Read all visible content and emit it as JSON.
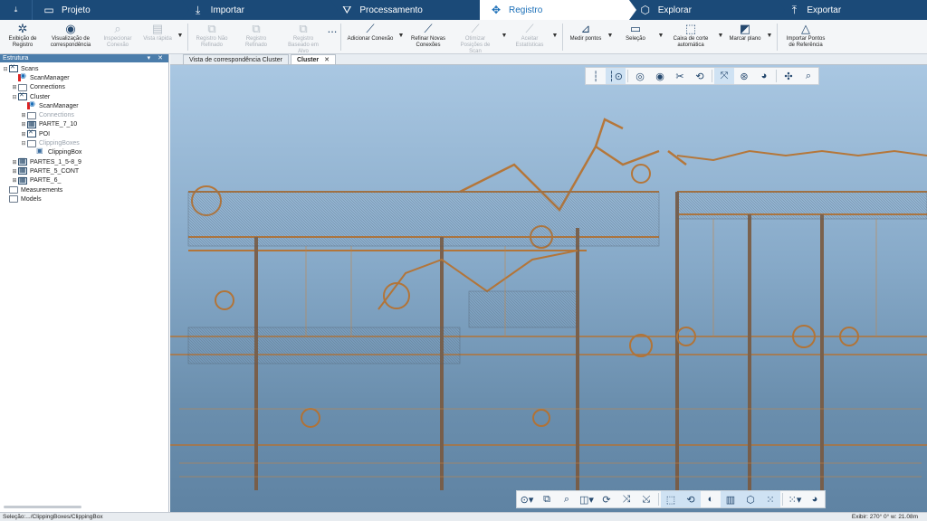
{
  "nav": {
    "tabs": [
      {
        "label": "Projeto",
        "icon": "folder-icon"
      },
      {
        "label": "Importar",
        "icon": "import-icon"
      },
      {
        "label": "Processamento",
        "icon": "filter-icon"
      },
      {
        "label": "Registro",
        "icon": "registration-icon"
      },
      {
        "label": "Explorar",
        "icon": "explore-icon"
      },
      {
        "label": "Exportar",
        "icon": "export-icon"
      }
    ],
    "active": "Registro"
  },
  "ribbon": {
    "buttons": [
      {
        "label": "Exibição de Registro",
        "icon": "registration-view-icon",
        "disabled": false
      },
      {
        "label": "Visualização de correspondência",
        "icon": "correspondence-view-icon",
        "disabled": false
      },
      {
        "label": "Inspecionar Conexão",
        "icon": "inspect-icon",
        "disabled": true
      },
      {
        "label": "Vista rápida",
        "icon": "quick-view-icon",
        "disabled": true
      },
      {
        "label": "Registro Não Refinado",
        "icon": "unrefined-icon",
        "disabled": true
      },
      {
        "label": "Registro Refinado",
        "icon": "refined-icon",
        "disabled": true
      },
      {
        "label": "Registro Baseado em Alvo",
        "icon": "target-icon",
        "disabled": true
      },
      {
        "label": "Adicionar Conexão",
        "icon": "add-connection-icon",
        "disabled": false
      },
      {
        "label": "Refinar Novas Conexões",
        "icon": "refine-icon",
        "disabled": false
      },
      {
        "label": "Otimizar Posições de Scan",
        "icon": "optimize-icon",
        "disabled": true
      },
      {
        "label": "Aceitar Estatísticas",
        "icon": "statistics-icon",
        "disabled": true
      },
      {
        "label": "Medir pontos",
        "icon": "measure-icon",
        "disabled": false
      },
      {
        "label": "Seleção",
        "icon": "selection-icon",
        "disabled": false
      },
      {
        "label": "Caixa de corte automática",
        "icon": "clipping-box-icon",
        "disabled": false
      },
      {
        "label": "Marcar plano",
        "icon": "mark-plane-icon",
        "disabled": false
      },
      {
        "label": "Importar Pontos de Referência",
        "icon": "reference-points-icon",
        "disabled": false
      }
    ],
    "more": "..."
  },
  "panel": {
    "title": "Estrutura",
    "controls": "▾ ✕",
    "tree": [
      {
        "label": "Scans",
        "level": 0,
        "exp": "⊟",
        "icon": "cluster",
        "dim": false
      },
      {
        "label": "ScanManager",
        "level": 1,
        "exp": "",
        "icon": "scan",
        "dim": false
      },
      {
        "label": "Connections",
        "level": 1,
        "exp": "⊞",
        "icon": "folder",
        "dim": false
      },
      {
        "label": "Cluster",
        "level": 1,
        "exp": "⊟",
        "icon": "cluster",
        "dim": false
      },
      {
        "label": "ScanManager",
        "level": 2,
        "exp": "",
        "icon": "scan",
        "dim": false
      },
      {
        "label": "Connections",
        "level": 2,
        "exp": "⊞",
        "icon": "folder",
        "dim": true
      },
      {
        "label": "PARTE_7_10",
        "level": 2,
        "exp": "⊞",
        "icon": "part",
        "dim": false
      },
      {
        "label": "POI",
        "level": 2,
        "exp": "⊞",
        "icon": "cluster",
        "dim": false
      },
      {
        "label": "ClippingBoxes",
        "level": 2,
        "exp": "⊟",
        "icon": "folder",
        "dim": true
      },
      {
        "label": "ClippingBox",
        "level": 3,
        "exp": "",
        "icon": "box",
        "dim": false
      },
      {
        "label": "PARTES_1_5-8_9",
        "level": 1,
        "exp": "⊞",
        "icon": "part",
        "dim": false
      },
      {
        "label": "PARTE_5_CONT",
        "level": 1,
        "exp": "⊞",
        "icon": "part",
        "dim": false
      },
      {
        "label": "PARTE_6_",
        "level": 1,
        "exp": "⊞",
        "icon": "part",
        "dim": false
      },
      {
        "label": "Measurements",
        "level": 0,
        "exp": "",
        "icon": "folder",
        "dim": false
      },
      {
        "label": "Models",
        "level": 0,
        "exp": "",
        "icon": "folder",
        "dim": false
      }
    ]
  },
  "doctabs": [
    {
      "label": "Vista de correspondência Cluster",
      "active": false
    },
    {
      "label": "Cluster",
      "active": true,
      "close": "✕"
    }
  ],
  "viewport": {
    "top_tools": [
      "measure-line-icon",
      "measure-point-icon",
      "eye-plane-icon",
      "eye-line-icon",
      "eye-cut-icon",
      "rotate-eye-icon",
      "fit-icon",
      "scan-color-icon",
      "color-wheel-icon",
      "navigate-icon",
      "zoom-scan-icon"
    ],
    "bottom_tools": [
      "orbit-icon",
      "views-icon",
      "zoom-icon",
      "cube-icon",
      "rotate-icon",
      "move-icon",
      "walk-icon",
      "box-view-icon",
      "refresh-view-icon",
      "contrast-icon",
      "grid-icon",
      "shield-icon",
      "dots-icon",
      "more-icon",
      "palette-icon"
    ]
  },
  "status": {
    "left": "Seleção:.../ClippingBoxes/ClippingBox",
    "right": "Exibir: 270° 0° w: 21.08m"
  },
  "colors": {
    "nav_bg": "#1b4a78",
    "accent": "#1b6fb8",
    "pointcloud": "#b8702a"
  }
}
